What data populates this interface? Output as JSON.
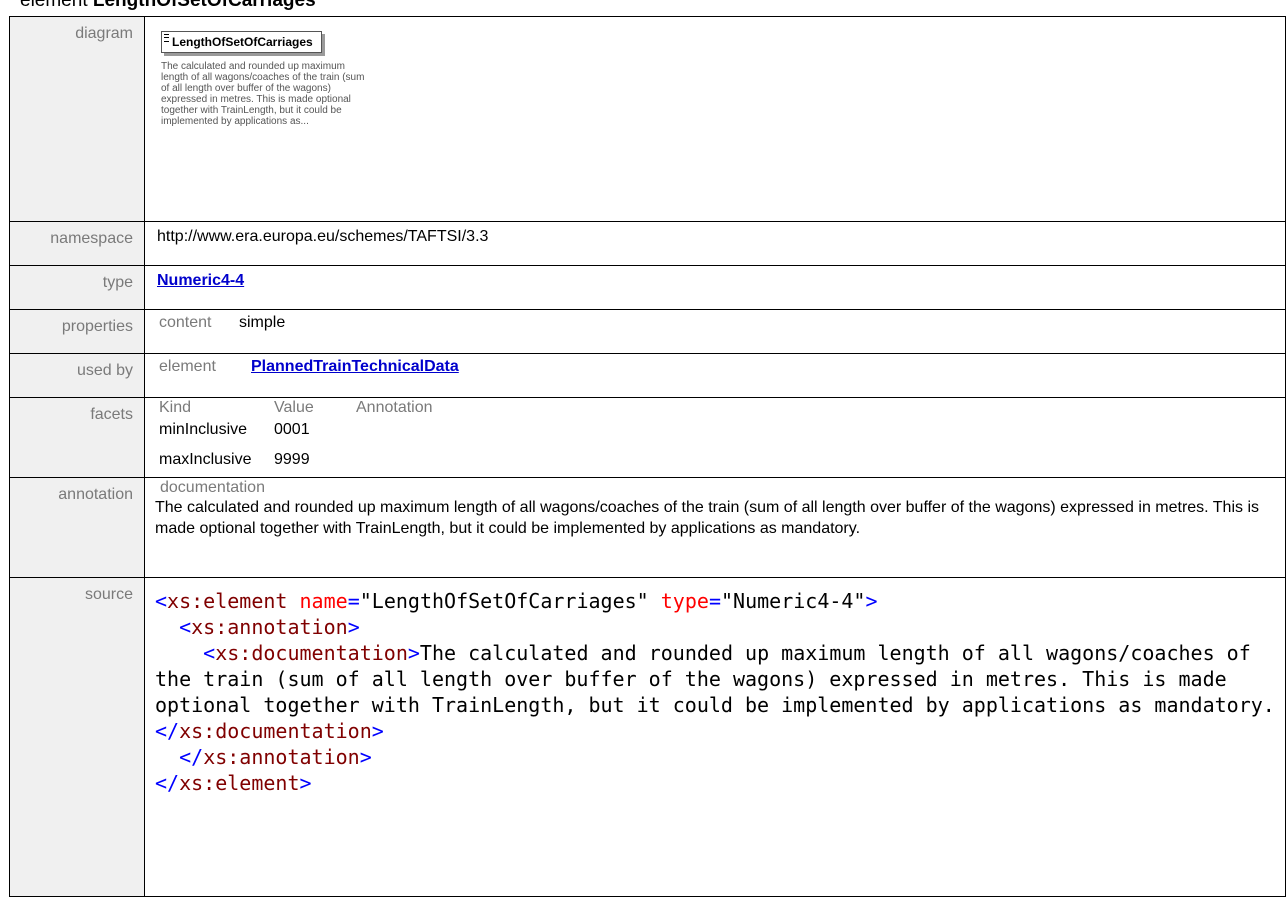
{
  "heading": {
    "prefix": "element ",
    "name": "LengthOfSetOfCarriages"
  },
  "labels": {
    "diagram": "diagram",
    "namespace": "namespace",
    "type": "type",
    "properties": "properties",
    "used_by": "used by",
    "facets": "facets",
    "annotation": "annotation",
    "source": "source"
  },
  "diagram": {
    "box_label": "LengthOfSetOfCarriages",
    "doc_preview": "The calculated and rounded up maximum length of all wagons/coaches of the train (sum of all length over buffer of the wagons) expressed in metres. This is made optional together with TrainLength, but it could be implemented by applications as..."
  },
  "namespace": "http://www.era.europa.eu/schemes/TAFTSI/3.3",
  "type_link": "Numeric4-4",
  "properties": {
    "key": "content",
    "value": "simple"
  },
  "used_by": {
    "kind": "element",
    "link": "PlannedTrainTechnicalData"
  },
  "facets": {
    "headers": [
      "Kind",
      "Value",
      "Annotation"
    ],
    "rows": [
      {
        "kind": "minInclusive",
        "value": "0001",
        "annotation": ""
      },
      {
        "kind": "maxInclusive",
        "value": "9999",
        "annotation": ""
      }
    ]
  },
  "annotation": {
    "title": "documentation",
    "text": "The calculated and rounded up maximum length of all wagons/coaches of the train (sum of all length over buffer of the wagons) expressed in metres. This is made optional together with TrainLength, but it could be implemented by applications as mandatory."
  },
  "source": {
    "l1_open": "<xs:element",
    "l1_attr1": "name",
    "l1_val1": "\"LengthOfSetOfCarriages\"",
    "l1_attr2": "type",
    "l1_val2": "\"Numeric4-4\"",
    "l2": "<xs:annotation>",
    "l3_open": "<xs:documentation>",
    "doc_text": "The calculated and rounded up maximum length of all wagons/coaches of the train (sum of all length over buffer of the wagons) expressed in metres. This is made optional together with TrainLength, but it could be implemented by applications as mandatory.",
    "l3_close": "</xs:documentation>",
    "l4": "</xs:annotation>",
    "l5": "</xs:element>"
  },
  "colors": {
    "label_bg": "#f0f0f0",
    "link": "#0000cc",
    "xml_tag": "#800000",
    "xml_attr": "#ff0000",
    "xml_punct": "#0000ff"
  }
}
